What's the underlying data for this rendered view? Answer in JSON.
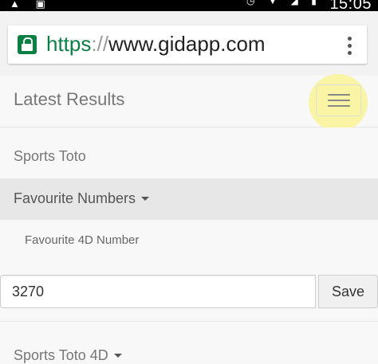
{
  "status_bar": {
    "left_icons": [
      "person-icon",
      "gallery-icon"
    ],
    "right_icons": [
      "alarm-icon",
      "wifi-icon",
      "signal-icon",
      "battery-icon"
    ],
    "time": "15:05"
  },
  "browser": {
    "url_scheme": "https",
    "url_separator": "://",
    "url_host": "www.gidapp.com",
    "secure_icon": "lock-icon",
    "menu_icon": "more-vert-icon",
    "secure_color": "#0b8043"
  },
  "navbar": {
    "brand": "Latest Results",
    "toggle_icon": "hamburger-icon"
  },
  "menu": {
    "sports_toto": "Sports Toto",
    "favourite_numbers": "Favourite Numbers",
    "favourite_4d_label": "Favourite 4D Number",
    "sports_toto_4d": "Sports Toto 4D"
  },
  "favourite_form": {
    "value": "3270",
    "save_label": "Save"
  },
  "highlight_color": "#f8f49a"
}
